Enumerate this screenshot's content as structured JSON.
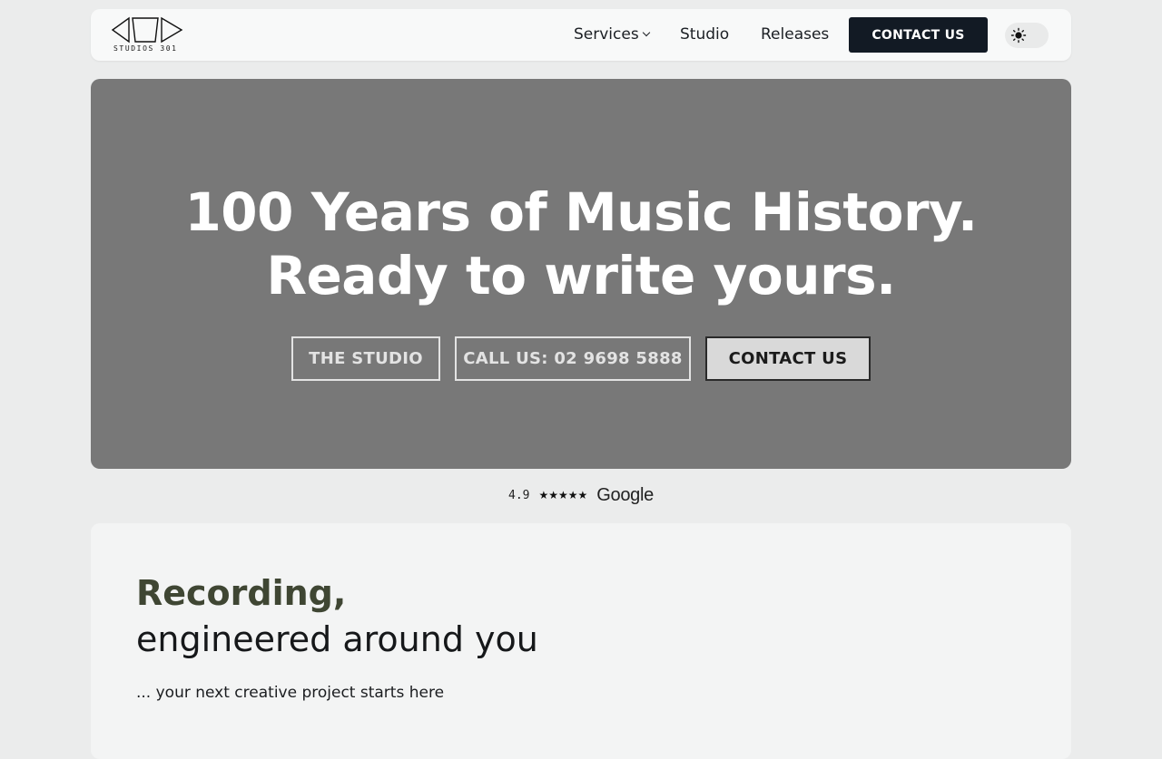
{
  "brand": {
    "logo_text": "STUDIOS 301"
  },
  "nav": {
    "services_label": "Services",
    "studio_label": "Studio",
    "releases_label": "Releases",
    "contact_label": "CONTACT US",
    "theme_icon": "sun-icon"
  },
  "hero": {
    "title_line1": "100 Years of Music History.",
    "title_line2": "Ready to write yours.",
    "buttons": {
      "studio": "THE STUDIO",
      "call": "CALL US: 02 9698 5888",
      "contact": "CONTACT US"
    },
    "background_color": "#787878"
  },
  "rating": {
    "score": "4.9",
    "stars": "★★★★★",
    "provider": "Google"
  },
  "section": {
    "heading": "Recording,",
    "subheading": "engineered around you",
    "tagline": "... your next creative project starts here"
  },
  "colors": {
    "accent_dark": "#121a24",
    "heading_olive": "#3f4633"
  }
}
